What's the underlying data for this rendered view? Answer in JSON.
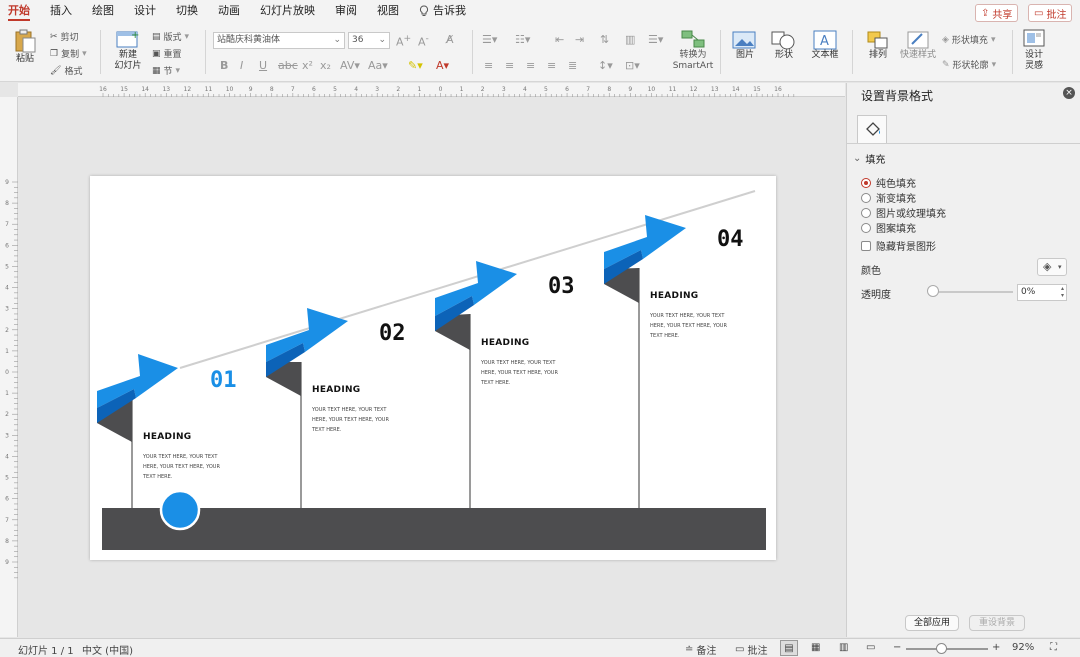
{
  "tabs": [
    "开始",
    "插入",
    "绘图",
    "设计",
    "切换",
    "动画",
    "幻灯片放映",
    "审阅",
    "视图",
    "告诉我"
  ],
  "top_buttons": {
    "share": "共享",
    "comment": "批注"
  },
  "ribbon": {
    "paste": "粘贴",
    "cut": "剪切",
    "copy": "复制",
    "format": "格式",
    "new_slide": "新建\n幻灯片",
    "layout": "版式",
    "reset": "重置",
    "section": "节",
    "font_name": "站酷庆科黄油体",
    "font_size": "36",
    "convert_smartart": "转换为\nSmartArt",
    "picture": "图片",
    "shape": "形状",
    "textbox": "文本框",
    "arrange": "排列",
    "quick_styles": "快速样式",
    "shape_fill": "形状填充",
    "shape_outline": "形状轮廓",
    "design_ideas": "设计\n灵感"
  },
  "slide": {
    "steps": [
      {
        "num": "01",
        "heading": "HEADING",
        "body": "YOUR TEXT HERE, YOUR TEXT HERE, YOUR TEXT HERE, YOUR TEXT HERE."
      },
      {
        "num": "02",
        "heading": "HEADING",
        "body": "YOUR TEXT HERE, YOUR TEXT HERE, YOUR TEXT HERE, YOUR TEXT HERE."
      },
      {
        "num": "03",
        "heading": "HEADING",
        "body": "YOUR TEXT HERE, YOUR TEXT HERE, YOUR TEXT HERE, YOUR TEXT HERE."
      },
      {
        "num": "04",
        "heading": "HEADING",
        "body": "YOUR TEXT HERE, YOUR TEXT HERE, YOUR TEXT HERE, YOUR TEXT HERE."
      }
    ],
    "colors": {
      "accent": "#1a8fe6",
      "accent_dark": "#0c63b8",
      "base": "#4d4d4f",
      "pole": "#9a9a9a"
    }
  },
  "panel": {
    "title": "设置背景格式",
    "section_fill": "填充",
    "options": [
      "纯色填充",
      "渐变填充",
      "图片或纹理填充",
      "图案填充"
    ],
    "selected_option": 0,
    "hide_bg_graphics": "隐藏背景图形",
    "color_label": "颜色",
    "transparency_label": "透明度",
    "transparency_value": "0%",
    "apply_all": "全部应用",
    "reset_bg": "重设背景"
  },
  "status": {
    "slide_info": "幻灯片 1 / 1",
    "language": "中文 (中国)",
    "notes": "备注",
    "comments": "批注",
    "zoom": "92%"
  },
  "hruler_labels": [
    "16",
    "15",
    "14",
    "13",
    "12",
    "11",
    "10",
    "9",
    "8",
    "7",
    "6",
    "5",
    "4",
    "3",
    "2",
    "1",
    "0",
    "1",
    "2",
    "3",
    "4",
    "5",
    "6",
    "7",
    "8",
    "9",
    "10",
    "11",
    "12",
    "13",
    "14",
    "15",
    "16"
  ],
  "vruler_labels": [
    "9",
    "8",
    "7",
    "6",
    "5",
    "4",
    "3",
    "2",
    "1",
    "0",
    "1",
    "2",
    "3",
    "4",
    "5",
    "6",
    "7",
    "8",
    "9"
  ]
}
